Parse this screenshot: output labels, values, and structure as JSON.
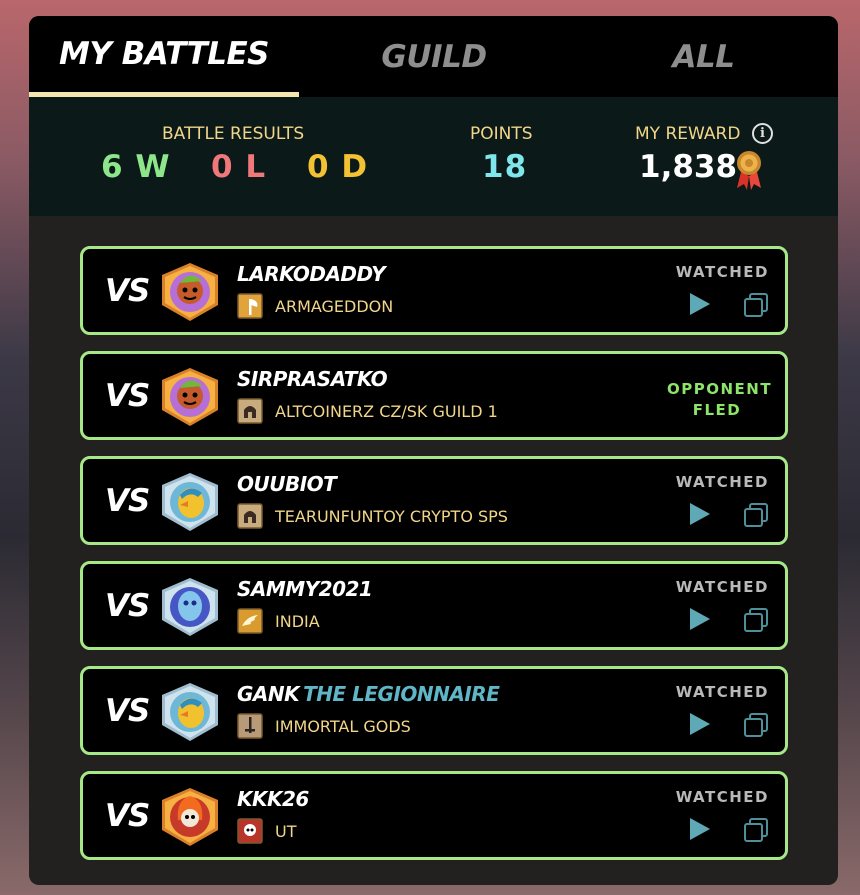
{
  "tabs": [
    {
      "label": "MY BATTLES",
      "active": true
    },
    {
      "label": "GUILD",
      "active": false
    },
    {
      "label": "ALL",
      "active": false
    }
  ],
  "summary": {
    "battle_results_label": "BATTLE RESULTS",
    "wins": "6 W",
    "losses": "0 L",
    "draws": "0 D",
    "points_label": "POINTS",
    "points": "18",
    "reward_label": "MY REWARD",
    "reward": "1,838",
    "info_icon": "info-icon",
    "reward_icon": "medal-icon"
  },
  "colors": {
    "wins": "#8ee68a",
    "losses": "#f0787a",
    "draws": "#f3c233",
    "points": "#7fe6ec",
    "card_border": "#a6e887",
    "guild_text": "#f1d68a",
    "title_text": "#5fb6c6"
  },
  "battles": [
    {
      "vs": "VS",
      "player": "LARKODADDY",
      "title": "",
      "guild": "ARMAGEDDON",
      "guild_icon": "axe-icon",
      "avatar": "green-goblin-avatar",
      "status": "WATCHED",
      "status_line2": ""
    },
    {
      "vs": "VS",
      "player": "SIRPRASATKO",
      "title": "",
      "guild": "ALTCOINERZ CZ/SK GUILD 1",
      "guild_icon": "helmet-icon",
      "avatar": "green-goblin-avatar",
      "status": "OPPONENT",
      "status_line2": "FLED"
    },
    {
      "vs": "VS",
      "player": "OUUBIOT",
      "title": "",
      "guild": "TEARUNFUNTOY CRYPTO SPS",
      "guild_icon": "helmet-icon",
      "avatar": "bird-avatar",
      "status": "WATCHED",
      "status_line2": ""
    },
    {
      "vs": "VS",
      "player": "SAMMY2021",
      "title": "",
      "guild": "INDIA",
      "guild_icon": "wing-icon",
      "avatar": "ghost-avatar",
      "status": "WATCHED",
      "status_line2": ""
    },
    {
      "vs": "VS",
      "player": "GANK",
      "title": "THE LEGIONNAIRE",
      "guild": "IMMORTAL GODS",
      "guild_icon": "sword-icon",
      "avatar": "bird-avatar",
      "status": "WATCHED",
      "status_line2": ""
    },
    {
      "vs": "VS",
      "player": "KKK26",
      "title": "",
      "guild": "UT",
      "guild_icon": "skull-icon",
      "avatar": "fire-skull-avatar",
      "status": "WATCHED",
      "status_line2": ""
    }
  ]
}
